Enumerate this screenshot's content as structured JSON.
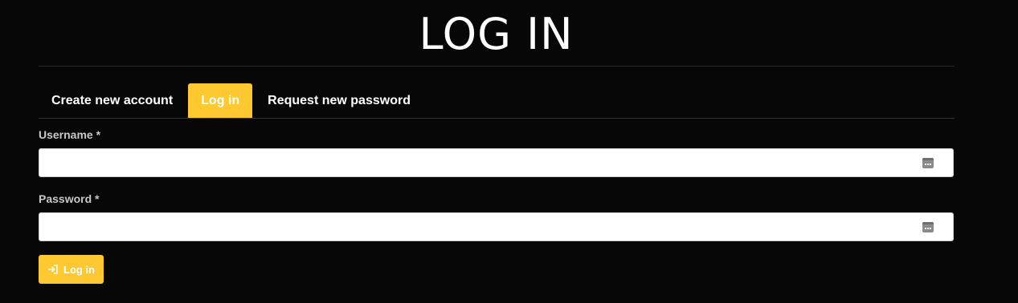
{
  "page": {
    "title": "LOG IN"
  },
  "tabs": [
    {
      "label": "Create new account",
      "active": false
    },
    {
      "label": "Log in",
      "active": true
    },
    {
      "label": "Request new password",
      "active": false
    }
  ],
  "form": {
    "username_label": "Username *",
    "username_value": "",
    "password_label": "Password *",
    "password_value": "",
    "submit_label": "Log in"
  },
  "colors": {
    "background": "#070707",
    "accent": "#fec830",
    "label": "#c8c8c8"
  },
  "icons": {
    "field_icon": "password-manager-key-icon",
    "submit_icon": "sign-in-icon"
  }
}
